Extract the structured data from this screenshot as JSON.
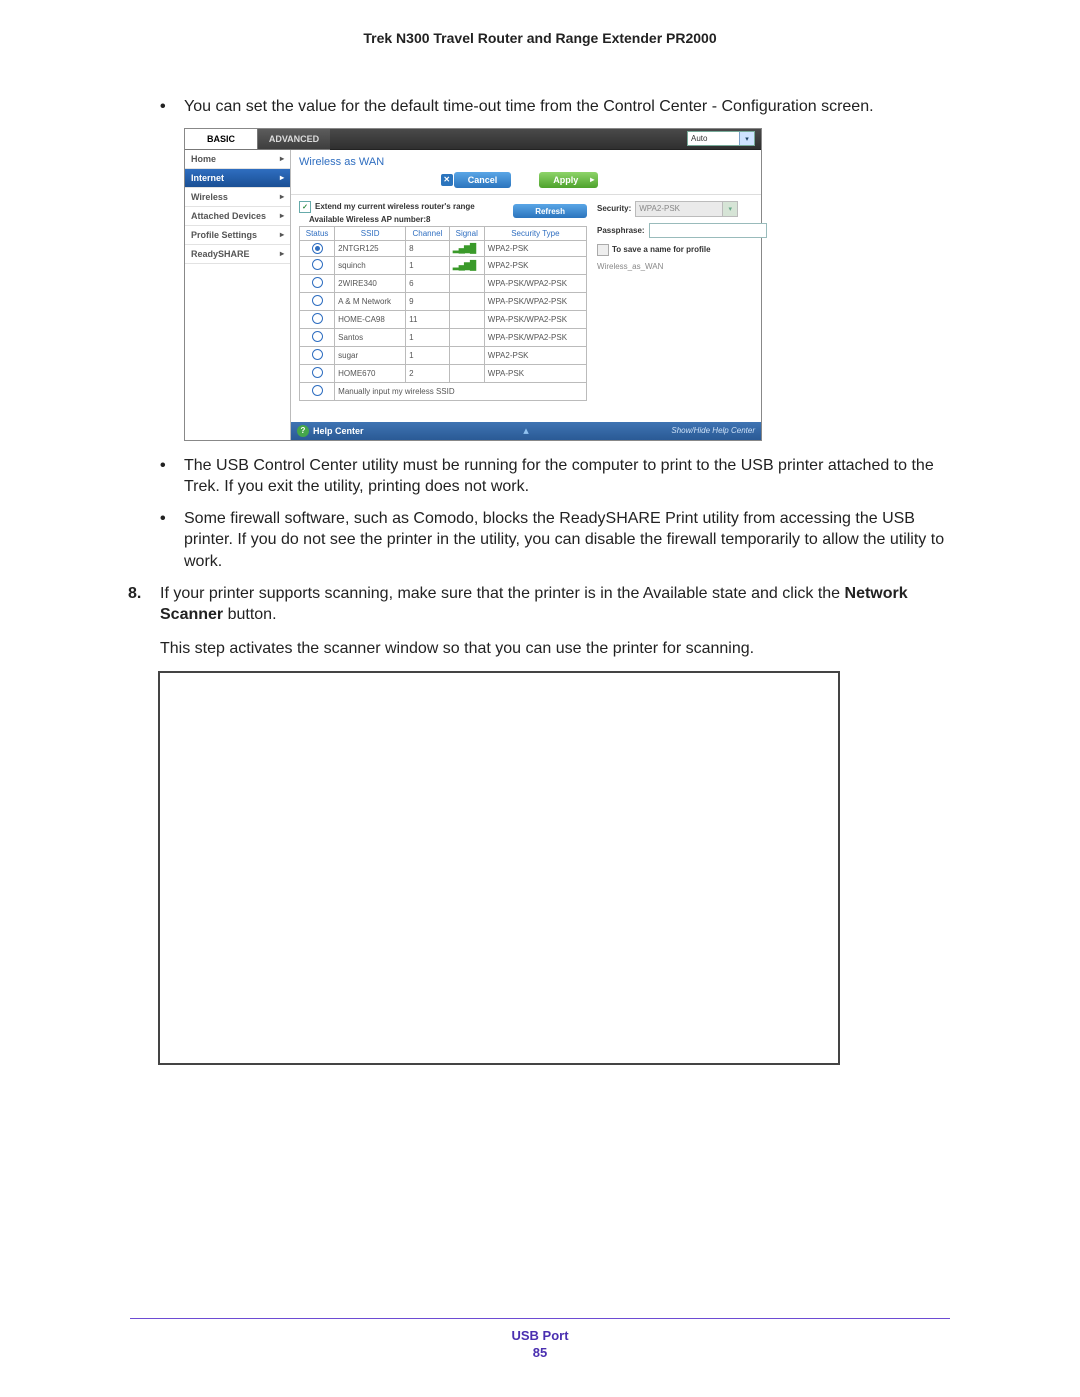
{
  "doc_title": "Trek N300 Travel Router and Range Extender PR2000",
  "bullets_pre": [
    "You can set the value for the default time-out time from the Control Center - Configuration screen."
  ],
  "screenshot": {
    "tabs": {
      "basic": "BASIC",
      "advanced": "ADVANCED",
      "auto": "Auto"
    },
    "sidebar": [
      {
        "label": "Home",
        "active": false
      },
      {
        "label": "Internet",
        "active": true
      },
      {
        "label": "Wireless",
        "active": false
      },
      {
        "label": "Attached Devices",
        "active": false
      },
      {
        "label": "Profile Settings",
        "active": false
      },
      {
        "label": "ReadySHARE",
        "active": false
      }
    ],
    "panel_title": "Wireless as WAN",
    "buttons": {
      "cancel": "Cancel",
      "apply": "Apply",
      "refresh": "Refresh"
    },
    "extend_check": "Extend my current wireless router's range",
    "ap_count_label": "Available Wireless AP number:8",
    "table": {
      "headers": {
        "status": "Status",
        "ssid": "SSID",
        "channel": "Channel",
        "signal": "Signal",
        "security": "Security Type"
      },
      "rows": [
        {
          "sel": true,
          "ssid": "2NTGR125",
          "ch": "8",
          "sig": 4,
          "sec": "WPA2-PSK"
        },
        {
          "sel": false,
          "ssid": "squinch",
          "ch": "1",
          "sig": 4,
          "sec": "WPA2-PSK"
        },
        {
          "sel": false,
          "ssid": "2WIRE340",
          "ch": "6",
          "sig": 0,
          "sec": "WPA-PSK/WPA2-PSK"
        },
        {
          "sel": false,
          "ssid": "A & M Network",
          "ch": "9",
          "sig": 0,
          "sec": "WPA-PSK/WPA2-PSK"
        },
        {
          "sel": false,
          "ssid": "HOME-CA98",
          "ch": "11",
          "sig": 0,
          "sec": "WPA-PSK/WPA2-PSK"
        },
        {
          "sel": false,
          "ssid": "Santos",
          "ch": "1",
          "sig": 0,
          "sec": "WPA-PSK/WPA2-PSK"
        },
        {
          "sel": false,
          "ssid": "sugar",
          "ch": "1",
          "sig": 0,
          "sec": "WPA2-PSK"
        },
        {
          "sel": false,
          "ssid": "HOME670",
          "ch": "2",
          "sig": 0,
          "sec": "WPA-PSK"
        }
      ],
      "manual_row": "Manually input my wireless SSID"
    },
    "form": {
      "security_label": "Security:",
      "security_value": "WPA2-PSK",
      "passphrase_label": "Passphrase:",
      "passphrase_value": "",
      "save_label": "To save a name for profile",
      "profile_name": "Wireless_as_WAN"
    },
    "help": {
      "left": "Help Center",
      "right": "Show/Hide Help Center"
    }
  },
  "bullets_post": [
    "The USB Control Center utility must be running for the computer to print to the USB printer attached to the Trek. If you exit the utility, printing does not work.",
    "Some firewall software, such as Comodo, blocks the ReadySHARE Print utility from accessing the USB printer. If you do not see the printer in the utility, you can disable the firewall temporarily to allow the utility to work."
  ],
  "step8": {
    "num": "8.",
    "pre": "If your printer supports scanning, make sure that the printer is in the Available state and click the ",
    "bold": "Network Scanner",
    "post": " button.",
    "follow": "This step activates the scanner window so that you can use the printer for scanning."
  },
  "footer": {
    "label": "USB Port",
    "page": "85"
  }
}
